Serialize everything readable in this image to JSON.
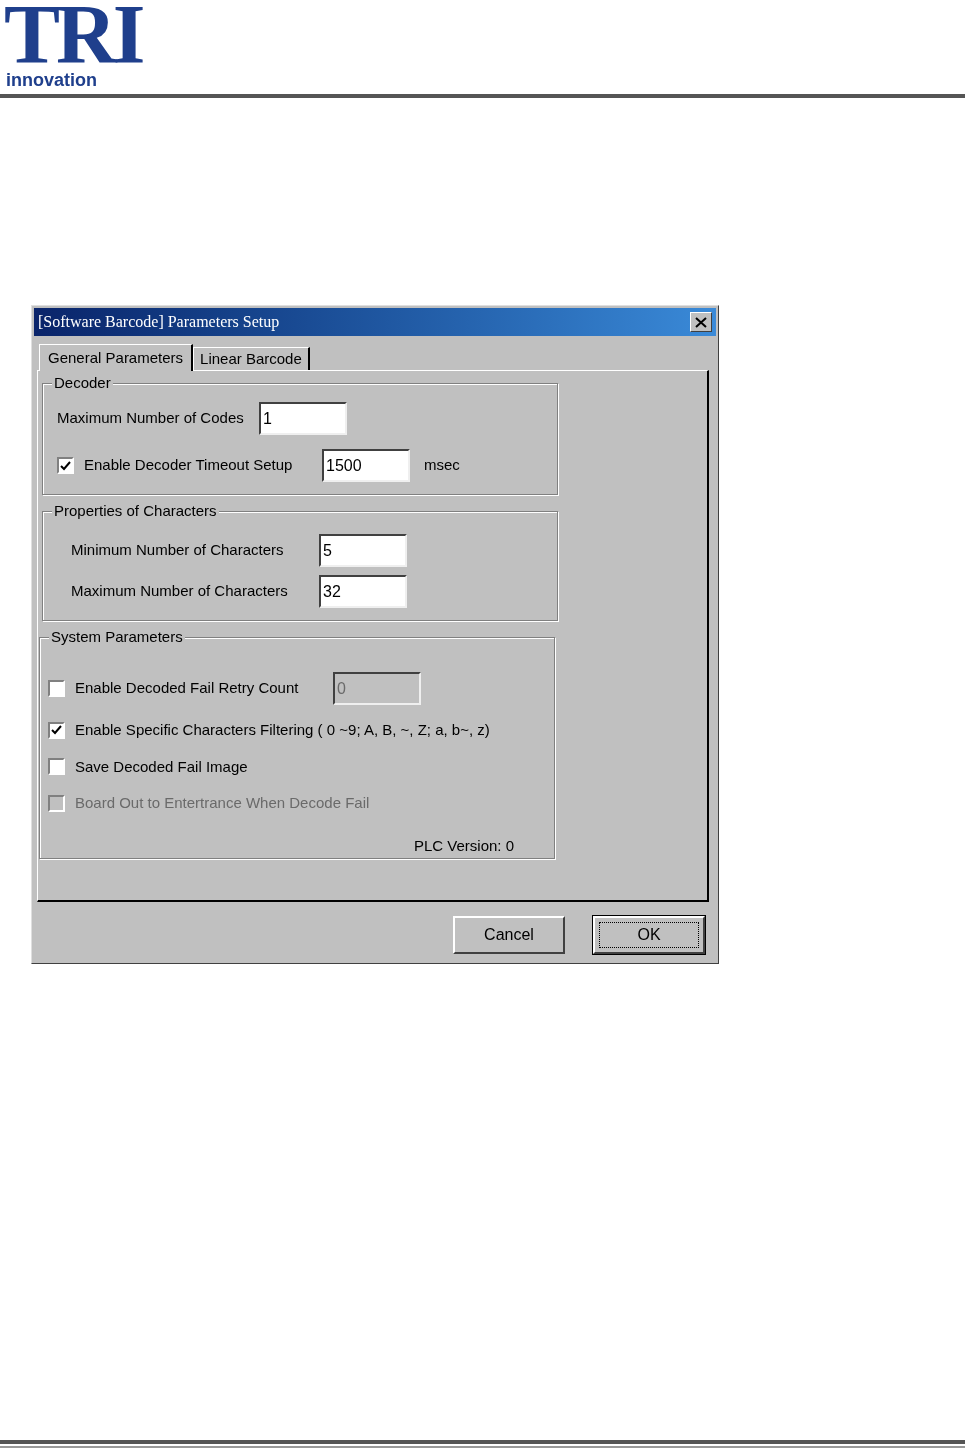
{
  "logo": {
    "mark": "TRI",
    "word": "innovation"
  },
  "dialog": {
    "title": "[Software Barcode] Parameters Setup",
    "tabs": [
      {
        "label": "General Parameters",
        "selected": true
      },
      {
        "label": "Linear Barcode",
        "selected": false
      }
    ],
    "groups": [
      {
        "title": "Decoder",
        "rows": [
          {
            "kind": "field",
            "label": "Maximum Number of Codes",
            "value": "1"
          },
          {
            "kind": "check_field",
            "label": "Enable Decoder Timeout Setup",
            "checked": true,
            "value": "1500",
            "unit": "msec"
          }
        ]
      },
      {
        "title": "Properties of Characters",
        "rows": [
          {
            "kind": "field",
            "label": "Minimum Number of Characters",
            "value": "5"
          },
          {
            "kind": "field",
            "label": "Maximum Number of Characters",
            "value": "32"
          }
        ]
      },
      {
        "title": "System Parameters",
        "rows": [
          {
            "kind": "check_field",
            "label": "Enable Decoded Fail Retry Count",
            "checked": false,
            "value": "0",
            "field_disabled": true
          },
          {
            "kind": "check",
            "label": "Enable Specific Characters Filtering ( 0 ~9; A, B, ~, Z; a, b~, z)",
            "checked": true
          },
          {
            "kind": "check",
            "label": "Save Decoded Fail Image",
            "checked": false
          },
          {
            "kind": "check",
            "label": "Board Out to Entertrance When Decode Fail",
            "checked": false,
            "disabled": true
          }
        ],
        "footer": "PLC Version: 0"
      }
    ],
    "buttons": [
      {
        "label": "Cancel",
        "default": false
      },
      {
        "label": "OK",
        "default": true
      }
    ]
  }
}
